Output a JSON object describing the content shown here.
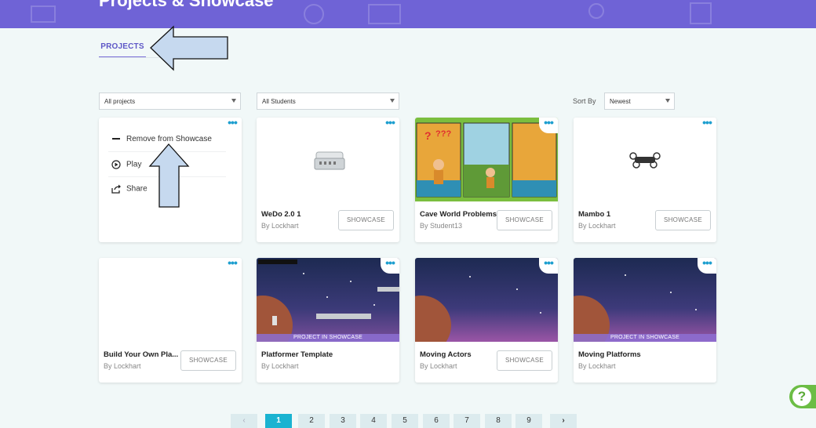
{
  "header": {
    "title": "Projects & Showcase"
  },
  "tabs": [
    {
      "label": "PROJECTS"
    }
  ],
  "filters": {
    "projects": "All projects",
    "students": "All Students",
    "sort_label": "Sort By",
    "sort": "Newest"
  },
  "context_menu": [
    {
      "label": "Remove from Showcase",
      "icon": "minus-icon"
    },
    {
      "label": "Play",
      "icon": "play-circle-icon"
    },
    {
      "label": "Share",
      "icon": "share-icon"
    }
  ],
  "cards": [
    {
      "title": "",
      "author": "",
      "has_menu_open": true
    },
    {
      "title": "WeDo 2.0 1",
      "author": "By Lockhart",
      "button": "SHOWCASE"
    },
    {
      "title": "Cave World Problems",
      "author": "By Student13",
      "button": "SHOWCASE",
      "thumb_labels": [
        "?",
        "???"
      ]
    },
    {
      "title": "Mambo 1",
      "author": "By Lockhart",
      "button": "SHOWCASE"
    },
    {
      "title": "Build Your Own Pla...",
      "author": "By Lockhart",
      "button": "SHOWCASE"
    },
    {
      "title": "Platformer Template",
      "author": "By Lockhart",
      "banner": "PROJECT IN SHOWCASE"
    },
    {
      "title": "Moving Actors",
      "author": "By Lockhart",
      "button": "SHOWCASE"
    },
    {
      "title": "Moving Platforms",
      "author": "By Lockhart",
      "banner": "PROJECT IN SHOWCASE"
    }
  ],
  "pagination": {
    "prev": "‹",
    "next": "›",
    "pages": [
      "1",
      "2",
      "3",
      "4",
      "5",
      "6",
      "7",
      "8",
      "9"
    ],
    "current": "1"
  },
  "help": {
    "label": "?"
  },
  "colors": {
    "header": "#6f63d6",
    "accent": "#1ab3d1",
    "help": "#6cbd45"
  }
}
